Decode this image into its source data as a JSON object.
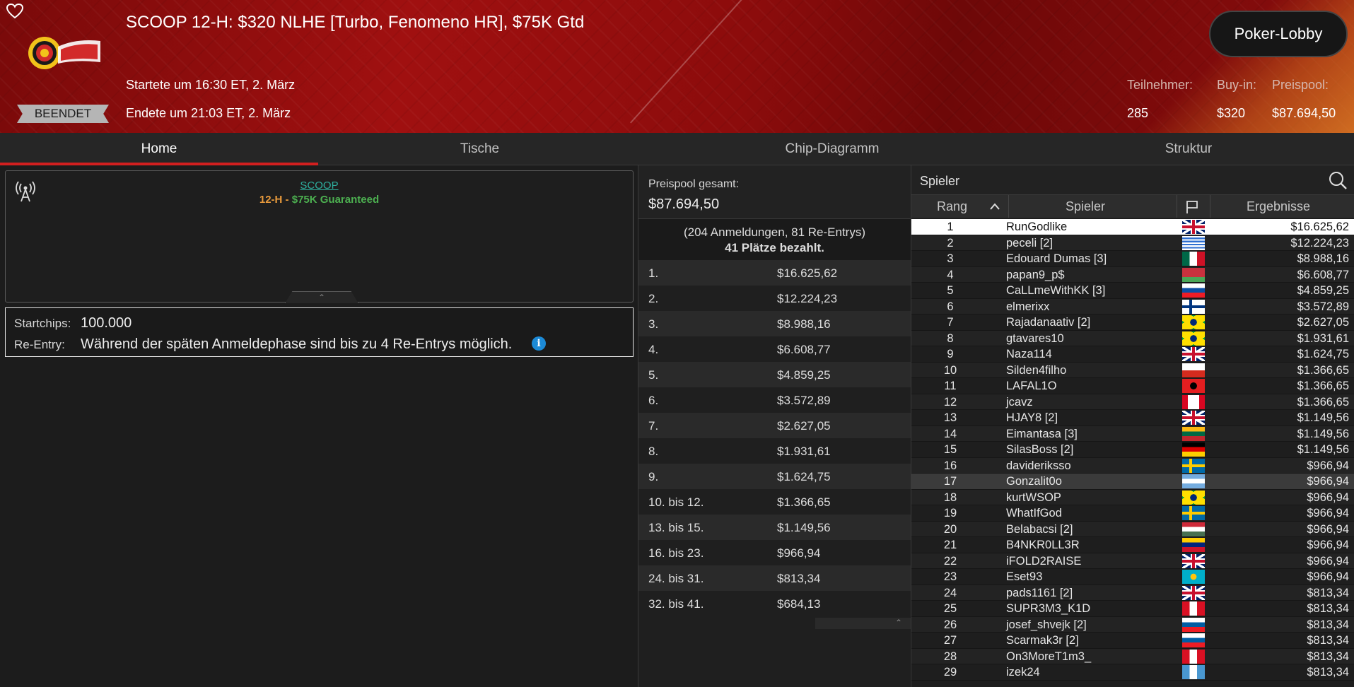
{
  "header": {
    "title": "SCOOP 12-H: $320 NLHE [Turbo, Fenomeno HR], $75K Gtd",
    "status": "BEENDET",
    "started": "Startete um 16:30 ET, 2. März",
    "ended": "Endete um 21:03 ET, 2. März",
    "lobby_button": "Poker-Lobby",
    "stats": [
      {
        "label": "Teilnehmer:",
        "value": "285"
      },
      {
        "label": "Buy-in:",
        "value": "$320"
      },
      {
        "label": "Preispool:",
        "value": "$87.694,50"
      }
    ]
  },
  "tabs": [
    "Home",
    "Tische",
    "Chip-Diagramm",
    "Struktur"
  ],
  "info": {
    "series_link": "SCOOP",
    "event_code": "12-H",
    "dash": " - ",
    "guarantee": "$75K Guaranteed",
    "startchips_label": "Startchips:",
    "startchips_value": "100.000",
    "reentry_label": "Re-Entry:",
    "reentry_value": "Während der späten Anmeldephase sind bis zu 4 Re-Entrys möglich.",
    "info_glyph": "i"
  },
  "prize": {
    "total_label": "Preispool gesamt:",
    "total_value": "$87.694,50",
    "entries_line": "(204 Anmeldungen, 81 Re-Entrys)",
    "paid_line": "41 Plätze bezahlt.",
    "payouts": [
      {
        "place": "1.",
        "amount": "$16.625,62"
      },
      {
        "place": "2.",
        "amount": "$12.224,23"
      },
      {
        "place": "3.",
        "amount": "$8.988,16"
      },
      {
        "place": "4.",
        "amount": "$6.608,77"
      },
      {
        "place": "5.",
        "amount": "$4.859,25"
      },
      {
        "place": "6.",
        "amount": "$3.572,89"
      },
      {
        "place": "7.",
        "amount": "$2.627,05"
      },
      {
        "place": "8.",
        "amount": "$1.931,61"
      },
      {
        "place": "9.",
        "amount": "$1.624,75"
      },
      {
        "place": "10. bis 12.",
        "amount": "$1.366,65"
      },
      {
        "place": "13. bis 15.",
        "amount": "$1.149,56"
      },
      {
        "place": "16. bis 23.",
        "amount": "$966,94"
      },
      {
        "place": "24. bis 31.",
        "amount": "$813,34"
      },
      {
        "place": "32. bis 41.",
        "amount": "$684,13"
      }
    ]
  },
  "players": {
    "panel_label": "Spieler",
    "col_rank": "Rang",
    "col_player": "Spieler",
    "col_result": "Ergebnisse",
    "rows": [
      {
        "rank": "1",
        "name": "RunGodlike",
        "flag": "gb",
        "result": "$16.625,62"
      },
      {
        "rank": "2",
        "name": "peceli [2]",
        "flag": "uy",
        "result": "$12.224,23"
      },
      {
        "rank": "3",
        "name": "Edouard Dumas [3]",
        "flag": "mx",
        "result": "$8.988,16"
      },
      {
        "rank": "4",
        "name": "papan9_p$",
        "flag": "by",
        "result": "$6.608,77"
      },
      {
        "rank": "5",
        "name": "CaLLmeWithKK [3]",
        "flag": "sk",
        "result": "$4.859,25"
      },
      {
        "rank": "6",
        "name": "elmerixx",
        "flag": "fi",
        "result": "$3.572,89"
      },
      {
        "rank": "7",
        "name": "Rajadanaativ [2]",
        "flag": "br",
        "result": "$2.627,05"
      },
      {
        "rank": "8",
        "name": "gtavares10",
        "flag": "br",
        "result": "$1.931,61"
      },
      {
        "rank": "9",
        "name": "Naza114",
        "flag": "gb",
        "result": "$1.624,75"
      },
      {
        "rank": "10",
        "name": "Silden4filho",
        "flag": "cl",
        "result": "$1.366,65"
      },
      {
        "rank": "11",
        "name": "LAFAL1O",
        "flag": "al",
        "result": "$1.366,65"
      },
      {
        "rank": "12",
        "name": "jcavz",
        "flag": "ca",
        "result": "$1.366,65"
      },
      {
        "rank": "13",
        "name": "HJAY8 [2]",
        "flag": "gb",
        "result": "$1.149,56"
      },
      {
        "rank": "14",
        "name": "Eimantasa [3]",
        "flag": "lt",
        "result": "$1.149,56"
      },
      {
        "rank": "15",
        "name": "SilasBoss [2]",
        "flag": "de",
        "result": "$1.149,56"
      },
      {
        "rank": "16",
        "name": "davideriksso",
        "flag": "se",
        "result": "$966,94"
      },
      {
        "rank": "17",
        "name": "Gonzalit0o",
        "flag": "ar",
        "result": "$966,94"
      },
      {
        "rank": "18",
        "name": "kurtWSOP",
        "flag": "br",
        "result": "$966,94"
      },
      {
        "rank": "19",
        "name": "WhatIfGod",
        "flag": "se",
        "result": "$966,94"
      },
      {
        "rank": "20",
        "name": "Belabacsi [2]",
        "flag": "hu",
        "result": "$966,94"
      },
      {
        "rank": "21",
        "name": "B4NKR0LL3R",
        "flag": "ve",
        "result": "$966,94"
      },
      {
        "rank": "22",
        "name": "iFOLD2RAISE",
        "flag": "gb",
        "result": "$966,94"
      },
      {
        "rank": "23",
        "name": "Eset93",
        "flag": "kz",
        "result": "$966,94"
      },
      {
        "rank": "24",
        "name": "pads1161 [2]",
        "flag": "gb",
        "result": "$813,34"
      },
      {
        "rank": "25",
        "name": "SUPR3M3_K1D",
        "flag": "pe",
        "result": "$813,34"
      },
      {
        "rank": "26",
        "name": "josef_shvejk [2]",
        "flag": "si",
        "result": "$813,34"
      },
      {
        "rank": "27",
        "name": "Scarmak3r [2]",
        "flag": "si",
        "result": "$813,34"
      },
      {
        "rank": "28",
        "name": "On3MoreT1m3_",
        "flag": "pe",
        "result": "$813,34"
      },
      {
        "rank": "29",
        "name": "izek24",
        "flag": "gt",
        "result": "$813,34"
      }
    ],
    "selected_index": 0,
    "hover_index": 16
  },
  "colors": {
    "accent_red": "#d21f1f",
    "header_red": "#a01010",
    "event_orange": "#e89a3c",
    "guarantee_green": "#4caf50",
    "link_teal": "#2eb0a0"
  }
}
